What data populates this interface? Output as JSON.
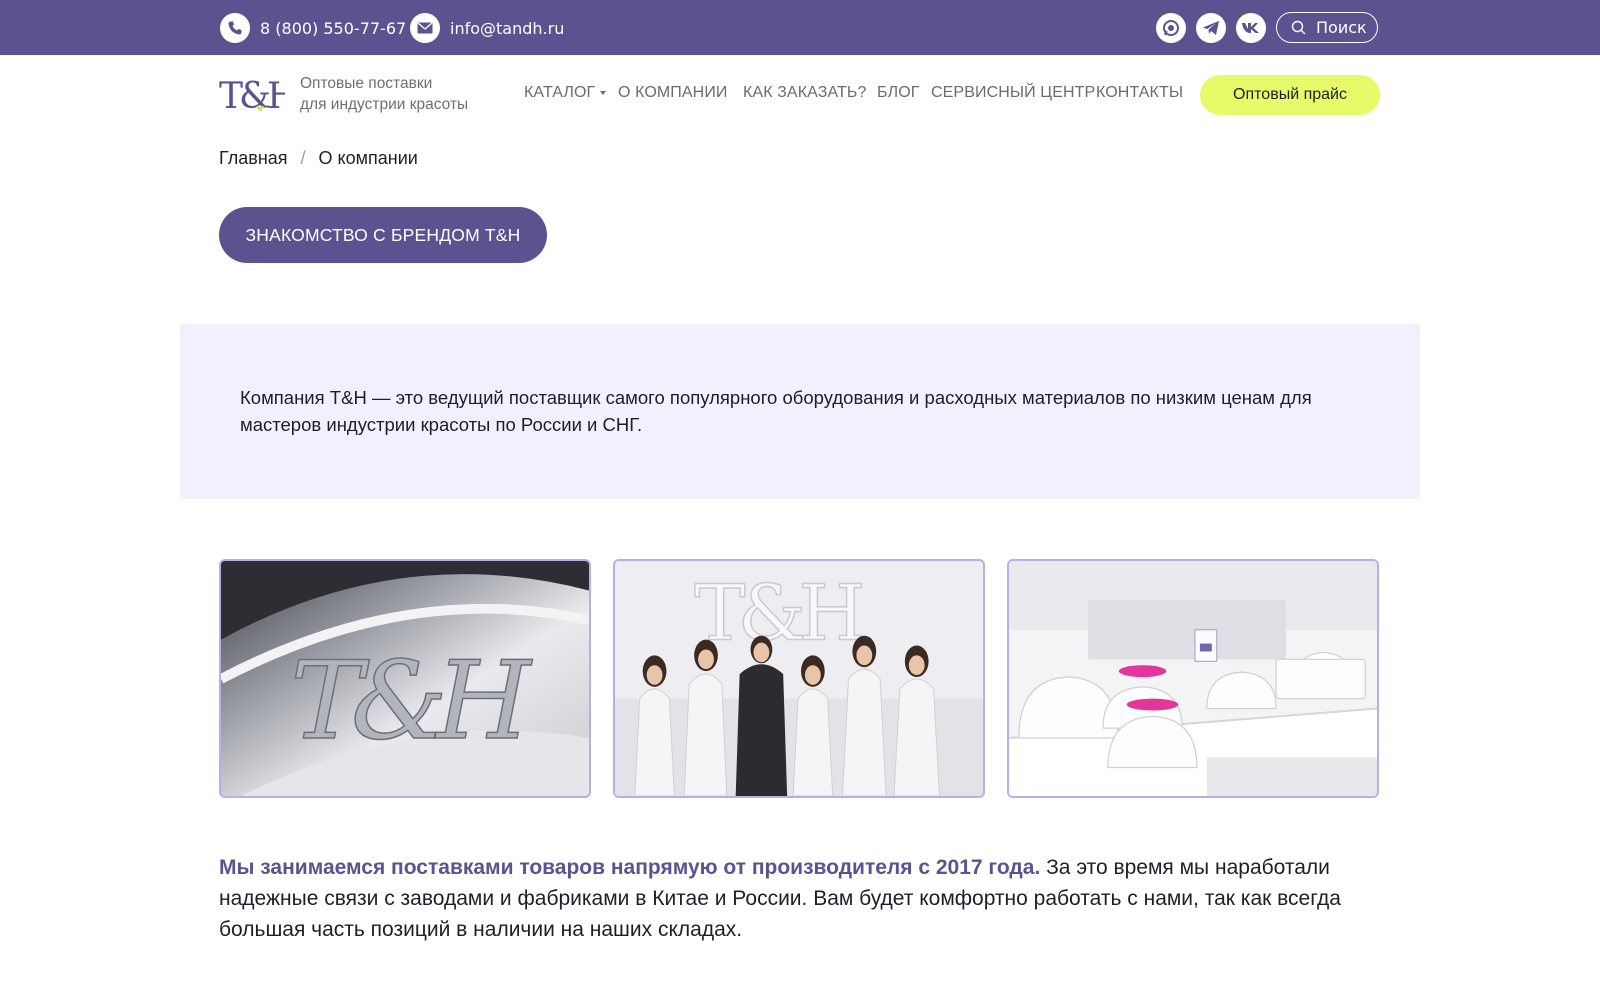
{
  "topbar": {
    "phone": "8 (800) 550-77-67",
    "email": "info@tandh.ru",
    "search_label": "Поиск",
    "socials": [
      "whatsapp-icon",
      "telegram-icon",
      "vk-icon"
    ],
    "bg_color": "#5d5290"
  },
  "header": {
    "logo_text": "T&H",
    "tagline_line1": "Оптовые поставки",
    "tagline_line2": "для индустрии красоты",
    "nav": [
      {
        "label": "КАТАЛОГ"
      },
      {
        "label": "О КОМПАНИИ"
      },
      {
        "label": "КАК ЗАКАЗАТЬ?"
      },
      {
        "label": "БЛОГ"
      },
      {
        "label": "СЕРВИСНЫЙ ЦЕНТР"
      },
      {
        "label": "КОНТАКТЫ"
      }
    ],
    "price_button": "Оптовый прайс",
    "accent_color": "#e7fa6a"
  },
  "breadcrumb": {
    "home": "Главная",
    "separator": "/",
    "current": "О компании"
  },
  "brand_button": "ЗНАКОМСТВО С БРЕНДОМ T&H",
  "intro": {
    "text": "Компания T&H — это ведущий поставщик самого популярного оборудования и расходных материалов по низким ценам для мастеров индустрии красоты по России и СНГ."
  },
  "photos": [
    {
      "name": "brand-sign-photo"
    },
    {
      "name": "team-photo"
    },
    {
      "name": "showroom-lamps-photo"
    }
  ],
  "about": {
    "highlight": "Мы занимаемся поставками товаров напрямую от производителя с 2017 года.",
    "text": " За это время мы наработали надежные связи с заводами и фабриками в Китае и России. Вам будет комфортно работать с нами, так как всегда большая часть позиций в наличии на наших складах."
  }
}
